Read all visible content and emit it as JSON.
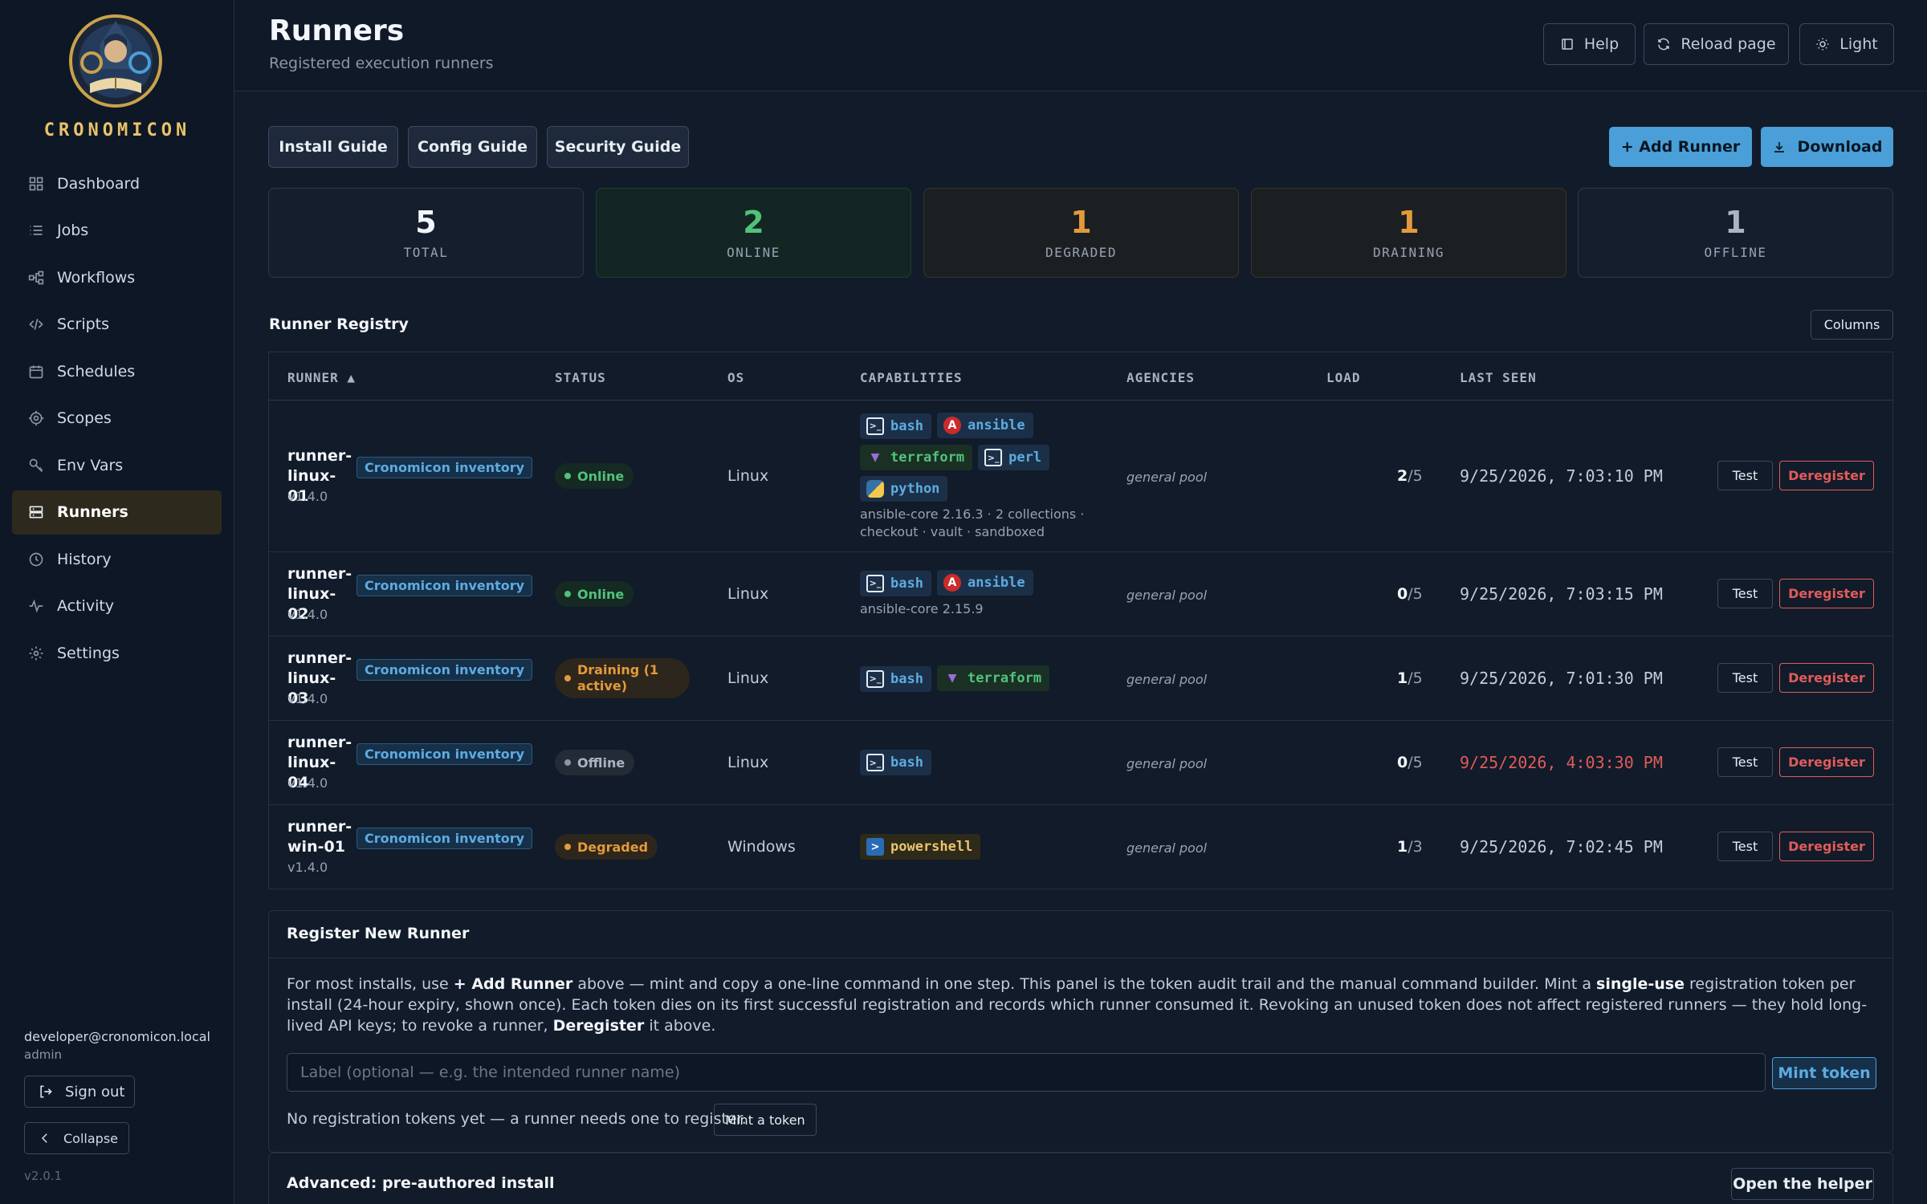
{
  "app": {
    "brand": "CRONOMICON",
    "version": "v2.0.1"
  },
  "sidebar": {
    "items": [
      {
        "label": "Dashboard",
        "icon": "grid-icon"
      },
      {
        "label": "Jobs",
        "icon": "list-icon"
      },
      {
        "label": "Workflows",
        "icon": "workflow-icon"
      },
      {
        "label": "Scripts",
        "icon": "code-icon"
      },
      {
        "label": "Schedules",
        "icon": "calendar-icon"
      },
      {
        "label": "Scopes",
        "icon": "scope-icon"
      },
      {
        "label": "Env Vars",
        "icon": "key-icon"
      },
      {
        "label": "Runners",
        "icon": "server-icon",
        "active": true
      },
      {
        "label": "History",
        "icon": "clock-icon"
      },
      {
        "label": "Activity",
        "icon": "activity-icon"
      },
      {
        "label": "Settings",
        "icon": "gear-icon"
      }
    ],
    "user_email": "developer@cronomicon.local",
    "user_role": "admin",
    "sign_out": "Sign out",
    "collapse": "Collapse"
  },
  "header": {
    "title": "Runners",
    "subtitle": "Registered execution runners",
    "help": "Help",
    "reload": "Reload page",
    "theme": "Light"
  },
  "guides": {
    "install": "Install Guide",
    "config": "Config Guide",
    "security": "Security Guide"
  },
  "actions": {
    "add_runner": "+ Add Runner",
    "download": "Download"
  },
  "stats": [
    {
      "value": "5",
      "label": "TOTAL",
      "color": "#f3f6fa"
    },
    {
      "value": "2",
      "label": "ONLINE",
      "color": "#52c27a"
    },
    {
      "value": "1",
      "label": "DEGRADED",
      "color": "#e39a3b"
    },
    {
      "value": "1",
      "label": "DRAINING",
      "color": "#e39a3b"
    },
    {
      "value": "1",
      "label": "OFFLINE",
      "color": "#aab4c2"
    }
  ],
  "registry": {
    "title": "Runner Registry",
    "columns_btn": "Columns",
    "headers": {
      "runner": "RUNNER ▲",
      "status": "STATUS",
      "os": "OS",
      "capabilities": "CAPABILITIES",
      "agencies": "AGENCIES",
      "load": "LOAD",
      "last_seen": "LAST SEEN"
    },
    "rows": [
      {
        "name": "runner-linux-01",
        "version": "v1.4.0",
        "tag": "Cronomicon inventory",
        "status": "Online",
        "os": "Linux",
        "caps": [
          "bash",
          "ansible",
          "terraform",
          "perl",
          "python"
        ],
        "cap_note": "ansible-core 2.16.3 · 2 collections · checkout · vault · sandboxed",
        "agency": "general pool",
        "load_cur": "2",
        "load_max": "/5",
        "seen": "9/25/2026, 7:03:10 PM",
        "test": "Test",
        "deregister": "Deregister"
      },
      {
        "name": "runner-linux-02",
        "version": "v1.4.0",
        "tag": "Cronomicon inventory",
        "status": "Online",
        "os": "Linux",
        "caps": [
          "bash",
          "ansible"
        ],
        "cap_note": "ansible-core 2.15.9",
        "agency": "general pool",
        "load_cur": "0",
        "load_max": "/5",
        "seen": "9/25/2026, 7:03:15 PM",
        "test": "Test",
        "deregister": "Deregister"
      },
      {
        "name": "runner-linux-03",
        "version": "v1.4.0",
        "tag": "Cronomicon inventory",
        "status": "Draining (1 active)",
        "os": "Linux",
        "caps": [
          "bash",
          "terraform"
        ],
        "cap_note": "",
        "agency": "general pool",
        "load_cur": "1",
        "load_max": "/5",
        "seen": "9/25/2026, 7:01:30 PM",
        "test": "Test",
        "deregister": "Deregister"
      },
      {
        "name": "runner-linux-04",
        "version": "v1.4.0",
        "tag": "Cronomicon inventory",
        "status": "Offline",
        "os": "Linux",
        "caps": [
          "bash"
        ],
        "cap_note": "",
        "agency": "general pool",
        "load_cur": "0",
        "load_max": "/5",
        "seen": "9/25/2026, 4:03:30 PM",
        "test": "Test",
        "deregister": "Deregister"
      },
      {
        "name": "runner-win-01",
        "version": "v1.4.0",
        "tag": "Cronomicon inventory",
        "status": "Degraded",
        "os": "Windows",
        "caps": [
          "powershell"
        ],
        "cap_note": "",
        "agency": "general pool",
        "load_cur": "1",
        "load_max": "/3",
        "seen": "9/25/2026, 7:02:45 PM",
        "test": "Test",
        "deregister": "Deregister"
      }
    ]
  },
  "register": {
    "title": "Register New Runner",
    "text_1": "For most installs, use ",
    "text_bold_1": "+ Add Runner",
    "text_2": " above — mint and copy a one-line command in one step. This panel is the token audit trail and the manual command builder. Mint a ",
    "text_bold_2": "single-use",
    "text_3": " registration token per install (24-hour expiry, shown once). Each token dies on its first successful registration and records which runner consumed it. Revoking an unused token does not affect registered runners — they hold long-lived API keys; to revoke a runner, ",
    "text_bold_3": "Deregister",
    "text_4": " it above.",
    "placeholder": "Label (optional — e.g. the intended runner name)",
    "mint": "Mint token",
    "no_tokens": "No registration tokens yet — a runner needs one to register.",
    "mint_a_token": "Mint a token"
  },
  "advanced": {
    "title": "Advanced: pre-authored install",
    "open": "Open the helper"
  }
}
